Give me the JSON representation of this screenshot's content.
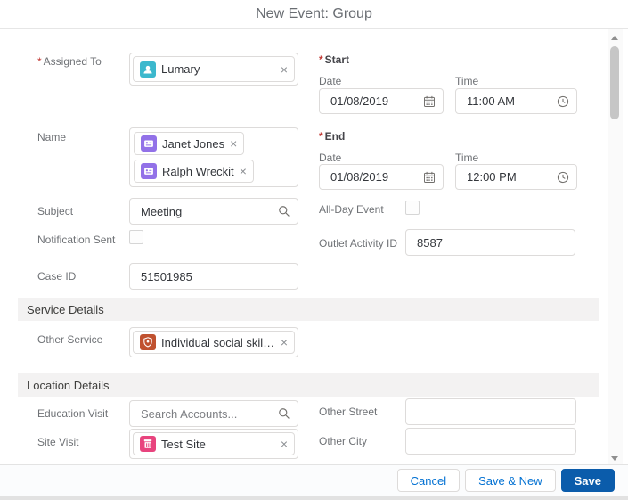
{
  "modal": {
    "title": "New Event: Group"
  },
  "required_marker": "*",
  "close_glyph": "×",
  "fields": {
    "assigned_to": {
      "label": "Assigned To",
      "required": true,
      "pill": {
        "icon": "user-avatar-icon",
        "text": "Lumary"
      }
    },
    "start": {
      "label": "Start",
      "required": true,
      "date_label": "Date",
      "time_label": "Time",
      "date_value": "01/08/2019",
      "time_value": "11:00 AM"
    },
    "name": {
      "label": "Name",
      "pills": [
        {
          "icon": "contact-avatar-icon",
          "text": "Janet Jones"
        },
        {
          "icon": "contact-avatar-icon",
          "text": "Ralph Wreckit"
        }
      ]
    },
    "end": {
      "label": "End",
      "required": true,
      "date_label": "Date",
      "time_label": "Time",
      "date_value": "01/08/2019",
      "time_value": "12:00 PM"
    },
    "subject": {
      "label": "Subject",
      "value": "Meeting"
    },
    "all_day_event": {
      "label": "All-Day Event",
      "checked": false
    },
    "notification_sent": {
      "label": "Notification Sent",
      "checked": false
    },
    "outlet_activity_id": {
      "label": "Outlet Activity ID",
      "value": "8587"
    },
    "case_id": {
      "label": "Case ID",
      "value": "51501985"
    },
    "other_service": {
      "label": "Other Service",
      "pill": {
        "icon": "service-shield-icon",
        "text": "Individual social skills develo..."
      }
    },
    "education_visit": {
      "label": "Education Visit",
      "placeholder": "Search Accounts..."
    },
    "other_street": {
      "label": "Other Street",
      "value": ""
    },
    "site_visit": {
      "label": "Site Visit",
      "pill": {
        "icon": "site-building-icon",
        "text": "Test Site"
      }
    },
    "other_city": {
      "label": "Other City",
      "value": ""
    }
  },
  "sections": {
    "service_details": "Service Details",
    "location_details": "Location Details"
  },
  "footer": {
    "cancel_label": "Cancel",
    "save_new_label": "Save & New",
    "save_label": "Save"
  },
  "colors": {
    "accent_blue": "#0070d2",
    "save_button_bg": "#0b5cab",
    "required_red": "#c23934",
    "section_bg": "#f3f2f2",
    "user_icon_bg": "#3cb8cd",
    "contact_icon_bg": "#9271e8",
    "service_icon_bg": "#c0512f",
    "site_icon_bg": "#e8447e"
  }
}
